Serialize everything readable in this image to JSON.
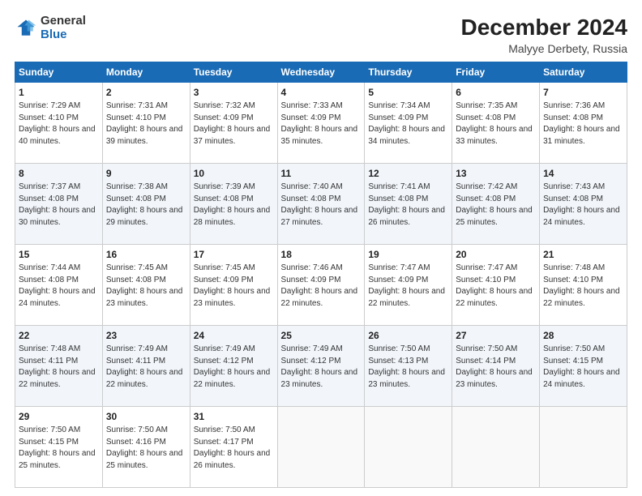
{
  "logo": {
    "general": "General",
    "blue": "Blue"
  },
  "title": "December 2024",
  "location": "Malyye Derbety, Russia",
  "days_of_week": [
    "Sunday",
    "Monday",
    "Tuesday",
    "Wednesday",
    "Thursday",
    "Friday",
    "Saturday"
  ],
  "weeks": [
    [
      {
        "day": "1",
        "sunrise": "7:29 AM",
        "sunset": "4:10 PM",
        "daylight": "8 hours and 40 minutes."
      },
      {
        "day": "2",
        "sunrise": "7:31 AM",
        "sunset": "4:10 PM",
        "daylight": "8 hours and 39 minutes."
      },
      {
        "day": "3",
        "sunrise": "7:32 AM",
        "sunset": "4:09 PM",
        "daylight": "8 hours and 37 minutes."
      },
      {
        "day": "4",
        "sunrise": "7:33 AM",
        "sunset": "4:09 PM",
        "daylight": "8 hours and 35 minutes."
      },
      {
        "day": "5",
        "sunrise": "7:34 AM",
        "sunset": "4:09 PM",
        "daylight": "8 hours and 34 minutes."
      },
      {
        "day": "6",
        "sunrise": "7:35 AM",
        "sunset": "4:08 PM",
        "daylight": "8 hours and 33 minutes."
      },
      {
        "day": "7",
        "sunrise": "7:36 AM",
        "sunset": "4:08 PM",
        "daylight": "8 hours and 31 minutes."
      }
    ],
    [
      {
        "day": "8",
        "sunrise": "7:37 AM",
        "sunset": "4:08 PM",
        "daylight": "8 hours and 30 minutes."
      },
      {
        "day": "9",
        "sunrise": "7:38 AM",
        "sunset": "4:08 PM",
        "daylight": "8 hours and 29 minutes."
      },
      {
        "day": "10",
        "sunrise": "7:39 AM",
        "sunset": "4:08 PM",
        "daylight": "8 hours and 28 minutes."
      },
      {
        "day": "11",
        "sunrise": "7:40 AM",
        "sunset": "4:08 PM",
        "daylight": "8 hours and 27 minutes."
      },
      {
        "day": "12",
        "sunrise": "7:41 AM",
        "sunset": "4:08 PM",
        "daylight": "8 hours and 26 minutes."
      },
      {
        "day": "13",
        "sunrise": "7:42 AM",
        "sunset": "4:08 PM",
        "daylight": "8 hours and 25 minutes."
      },
      {
        "day": "14",
        "sunrise": "7:43 AM",
        "sunset": "4:08 PM",
        "daylight": "8 hours and 24 minutes."
      }
    ],
    [
      {
        "day": "15",
        "sunrise": "7:44 AM",
        "sunset": "4:08 PM",
        "daylight": "8 hours and 24 minutes."
      },
      {
        "day": "16",
        "sunrise": "7:45 AM",
        "sunset": "4:08 PM",
        "daylight": "8 hours and 23 minutes."
      },
      {
        "day": "17",
        "sunrise": "7:45 AM",
        "sunset": "4:09 PM",
        "daylight": "8 hours and 23 minutes."
      },
      {
        "day": "18",
        "sunrise": "7:46 AM",
        "sunset": "4:09 PM",
        "daylight": "8 hours and 22 minutes."
      },
      {
        "day": "19",
        "sunrise": "7:47 AM",
        "sunset": "4:09 PM",
        "daylight": "8 hours and 22 minutes."
      },
      {
        "day": "20",
        "sunrise": "7:47 AM",
        "sunset": "4:10 PM",
        "daylight": "8 hours and 22 minutes."
      },
      {
        "day": "21",
        "sunrise": "7:48 AM",
        "sunset": "4:10 PM",
        "daylight": "8 hours and 22 minutes."
      }
    ],
    [
      {
        "day": "22",
        "sunrise": "7:48 AM",
        "sunset": "4:11 PM",
        "daylight": "8 hours and 22 minutes."
      },
      {
        "day": "23",
        "sunrise": "7:49 AM",
        "sunset": "4:11 PM",
        "daylight": "8 hours and 22 minutes."
      },
      {
        "day": "24",
        "sunrise": "7:49 AM",
        "sunset": "4:12 PM",
        "daylight": "8 hours and 22 minutes."
      },
      {
        "day": "25",
        "sunrise": "7:49 AM",
        "sunset": "4:12 PM",
        "daylight": "8 hours and 23 minutes."
      },
      {
        "day": "26",
        "sunrise": "7:50 AM",
        "sunset": "4:13 PM",
        "daylight": "8 hours and 23 minutes."
      },
      {
        "day": "27",
        "sunrise": "7:50 AM",
        "sunset": "4:14 PM",
        "daylight": "8 hours and 23 minutes."
      },
      {
        "day": "28",
        "sunrise": "7:50 AM",
        "sunset": "4:15 PM",
        "daylight": "8 hours and 24 minutes."
      }
    ],
    [
      {
        "day": "29",
        "sunrise": "7:50 AM",
        "sunset": "4:15 PM",
        "daylight": "8 hours and 25 minutes."
      },
      {
        "day": "30",
        "sunrise": "7:50 AM",
        "sunset": "4:16 PM",
        "daylight": "8 hours and 25 minutes."
      },
      {
        "day": "31",
        "sunrise": "7:50 AM",
        "sunset": "4:17 PM",
        "daylight": "8 hours and 26 minutes."
      },
      null,
      null,
      null,
      null
    ]
  ]
}
